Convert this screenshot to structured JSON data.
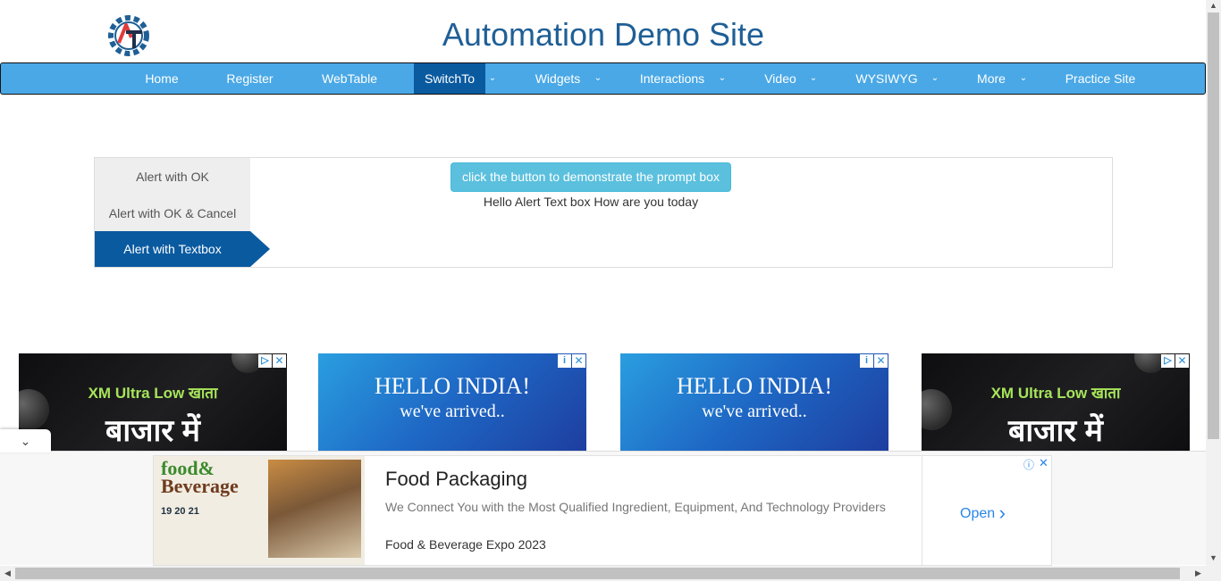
{
  "header": {
    "logo_icon": "automation-testing-gear-logo",
    "title": "Automation Demo Site"
  },
  "nav": {
    "items": [
      {
        "label": "Home"
      },
      {
        "label": "Register"
      },
      {
        "label": "WebTable"
      },
      {
        "label": "SwitchTo",
        "active": true,
        "dropdown": true
      },
      {
        "label": "Widgets",
        "dropdown": true
      },
      {
        "label": "Interactions",
        "dropdown": true
      },
      {
        "label": "Video",
        "dropdown": true
      },
      {
        "label": "WYSIWYG",
        "dropdown": true
      },
      {
        "label": "More",
        "dropdown": true
      },
      {
        "label": "Practice Site"
      }
    ],
    "colors": {
      "bar": "#4aa8e6",
      "active": "#0a5aa0"
    }
  },
  "alerts": {
    "tabs": [
      {
        "label": "Alert with OK"
      },
      {
        "label": "Alert with OK & Cancel"
      },
      {
        "label": "Alert with Textbox",
        "active": true
      }
    ],
    "prompt_button": "click the button to demonstrate the prompt box",
    "result_text": "Hello Alert Text box How are you today"
  },
  "ads": {
    "xm_line1": "XM Ultra Low खाता",
    "xm_line2": "बाजार में",
    "hello_line1": "HELLO INDIA!",
    "hello_line2": "we've arrived..",
    "info_icon": "info-icon",
    "close_icon": "close-icon"
  },
  "banner": {
    "image_title_1": "food&",
    "image_title_2": "Beverage",
    "image_dates": "19 20 21",
    "headline": "Food Packaging",
    "description": "We Connect You with the Most Qualified Ingredient, Equipment, And Technology Providers",
    "brand": "Food & Beverage Expo 2023",
    "open_label": "Open",
    "open_icon": "chevron-right-icon"
  }
}
